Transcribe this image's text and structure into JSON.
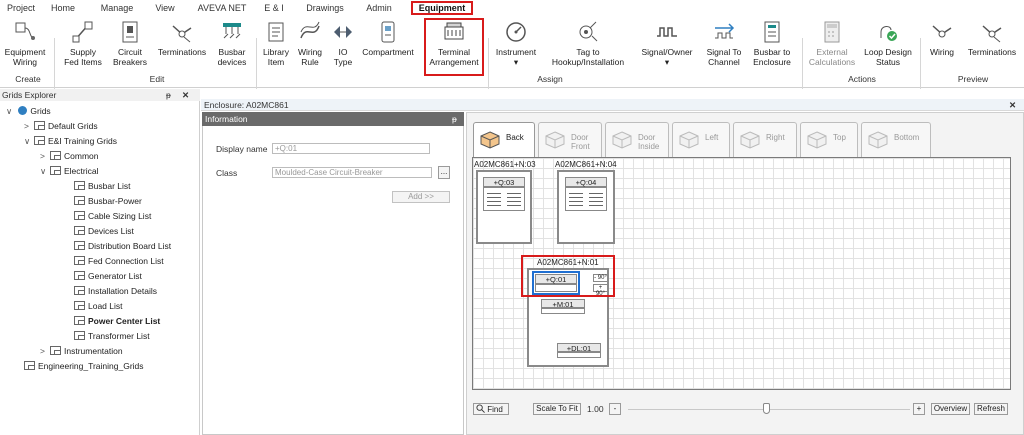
{
  "menu": {
    "tabs": [
      "Project",
      "Home",
      "Manage",
      "View",
      "AVEVA NET",
      "E & I",
      "Drawings",
      "Admin",
      "Equipment"
    ],
    "active": "Equipment"
  },
  "ribbon": {
    "equipment_wiring": "Equipment\nWiring",
    "supply_fed_items": "Supply\nFed Items",
    "circuit_breakers": "Circuit\nBreakers",
    "terminations": "Terminations",
    "busbar_devices": "Busbar\ndevices",
    "library_item": "Library\nItem",
    "wiring_rule": "Wiring\nRule",
    "io_type": "IO\nType",
    "compartment": "Compartment",
    "terminal_arrangement": "Terminal\nArrangement",
    "instrument": "Instrument",
    "tag_to_hookup": "Tag to\nHookup/Installation",
    "signal_owner": "Signal/Owner",
    "signal_to_channel": "Signal To\nChannel",
    "busbar_to_enclosure": "Busbar to\nEnclosure",
    "external_calculations": "External\nCalculations",
    "loop_design_status": "Loop Design\nStatus",
    "wiring": "Wiring",
    "terminations_preview": "Terminations",
    "groups": {
      "create": "Create",
      "edit": "Edit",
      "assign": "Assign",
      "actions": "Actions",
      "preview": "Preview"
    },
    "dropdown_marker": "▾"
  },
  "explorer": {
    "title": "Grids Explorer",
    "pin": "ᵽ",
    "close": "✕",
    "items": [
      {
        "label": "Grids",
        "caret": "∨"
      },
      {
        "label": "Default Grids",
        "caret": ">"
      },
      {
        "label": "E&I Training Grids",
        "caret": "∨"
      },
      {
        "label": "Common",
        "caret": ">"
      },
      {
        "label": "Electrical",
        "caret": "∨"
      },
      {
        "label": "Busbar List",
        "caret": ""
      },
      {
        "label": "Busbar-Power",
        "caret": ""
      },
      {
        "label": "Cable Sizing List",
        "caret": ""
      },
      {
        "label": "Devices List",
        "caret": ""
      },
      {
        "label": "Distribution Board List",
        "caret": ""
      },
      {
        "label": "Fed Connection List",
        "caret": ""
      },
      {
        "label": "Generator List",
        "caret": ""
      },
      {
        "label": "Installation Details",
        "caret": ""
      },
      {
        "label": "Load List",
        "caret": ""
      },
      {
        "label": "Power Center List",
        "caret": ""
      },
      {
        "label": "Transformer List",
        "caret": ""
      },
      {
        "label": "Instrumentation",
        "caret": ">"
      },
      {
        "label": "Engineering_Training_Grids",
        "caret": ""
      }
    ]
  },
  "enclosure": {
    "title": "Enclosure: A02MC861",
    "close": "✕"
  },
  "information": {
    "header": "Information",
    "pin": "ᵽ",
    "display_name_label": "Display name",
    "display_name_value": "+Q:01",
    "class_label": "Class",
    "class_value": "Moulded-Case Circuit-Breaker",
    "ellipsis": "...",
    "add_button": "Add >>"
  },
  "view_tabs": [
    "Back",
    "Door\nFront",
    "Door\nInside",
    "Left",
    "Right",
    "Top",
    "Bottom"
  ],
  "active_view": "Back",
  "cabinets": {
    "n03": {
      "label": "A02MC861+N:03",
      "device": "+Q:03"
    },
    "n04": {
      "label": "A02MC861+N:04",
      "device": "+Q:04"
    },
    "n01": {
      "label": "A02MC861+N:01",
      "q01": "+Q:01",
      "rot_neg": "- 90°",
      "rot_pos": "+ 90°",
      "m01": "+M:01",
      "dl01": "+DL:01"
    }
  },
  "bottom": {
    "find": "Find",
    "scale_to_fit": "Scale To Fit",
    "zoom_value": "1.00",
    "minus": "-",
    "plus": "+",
    "overview": "Overview",
    "refresh": "Refresh"
  },
  "colors": {
    "highlight_red": "#d81b1b",
    "selection_blue": "#1f6fd1",
    "panel_header": "#6a6a6a"
  }
}
